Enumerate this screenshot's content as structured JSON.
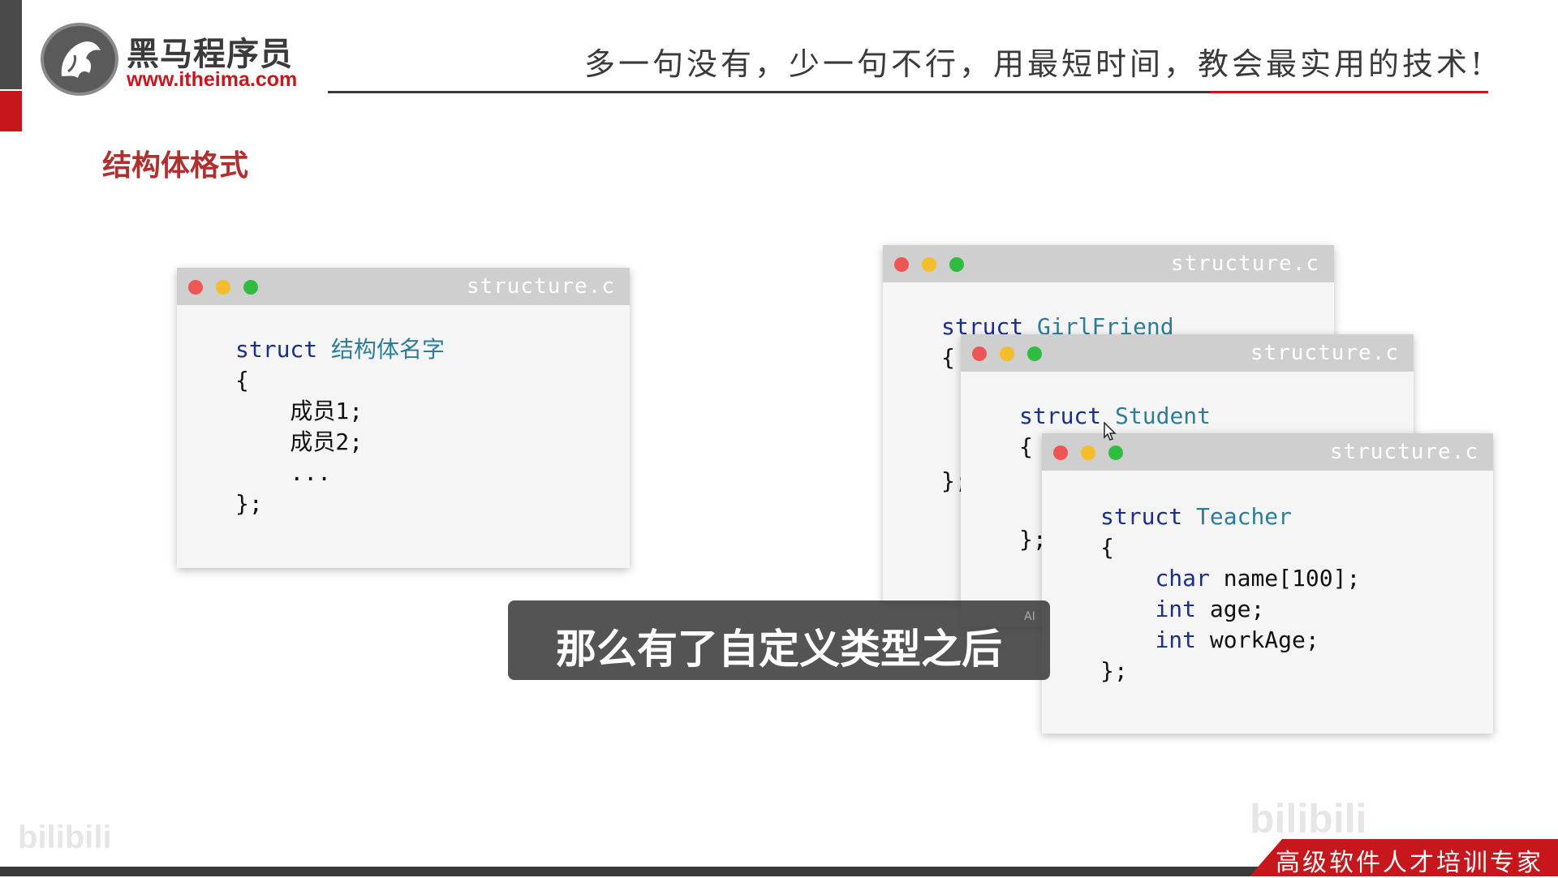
{
  "header": {
    "logo_cn": "黑马程序员",
    "logo_url": "www.itheima.com",
    "slogan": "多一句没有，少一句不行，用最短时间，教会最实用的技术!"
  },
  "section_title": "结构体格式",
  "windows": [
    {
      "title": "structure.c",
      "lines": [
        {
          "kw": "struct",
          "ty": "结构体名字",
          "rest": ""
        },
        {
          "text": "{"
        },
        {
          "text": "    成员1;"
        },
        {
          "text": "    成员2;"
        },
        {
          "text": "    ..."
        },
        {
          "text": "};"
        }
      ]
    },
    {
      "title": "structure.c",
      "kw": "struct",
      "ty": "GirlFriend",
      "brace_open": "{",
      "brace_close": "};"
    },
    {
      "title": "structure.c",
      "kw": "struct",
      "ty": "Student",
      "brace_open": "{",
      "brace_close": "};"
    },
    {
      "title": "structure.c",
      "kw": "struct",
      "ty": "Teacher",
      "brace_open": "{",
      "members": [
        {
          "type": "char",
          "name": "name[100];"
        },
        {
          "type": "int",
          "name": "age;"
        },
        {
          "type": "int",
          "name": "workAge;"
        }
      ],
      "brace_close": "};"
    }
  ],
  "subtitle": "那么有了自定义类型之后",
  "ai_tag": "AI",
  "footer": {
    "banner": "高级软件人才培训专家",
    "watermark_left": "bilibili",
    "watermark_right": "bilibili"
  },
  "colors": {
    "brand_red": "#c8161d",
    "keyword": "#1a2f8a",
    "type_name": "#2c7d95"
  }
}
